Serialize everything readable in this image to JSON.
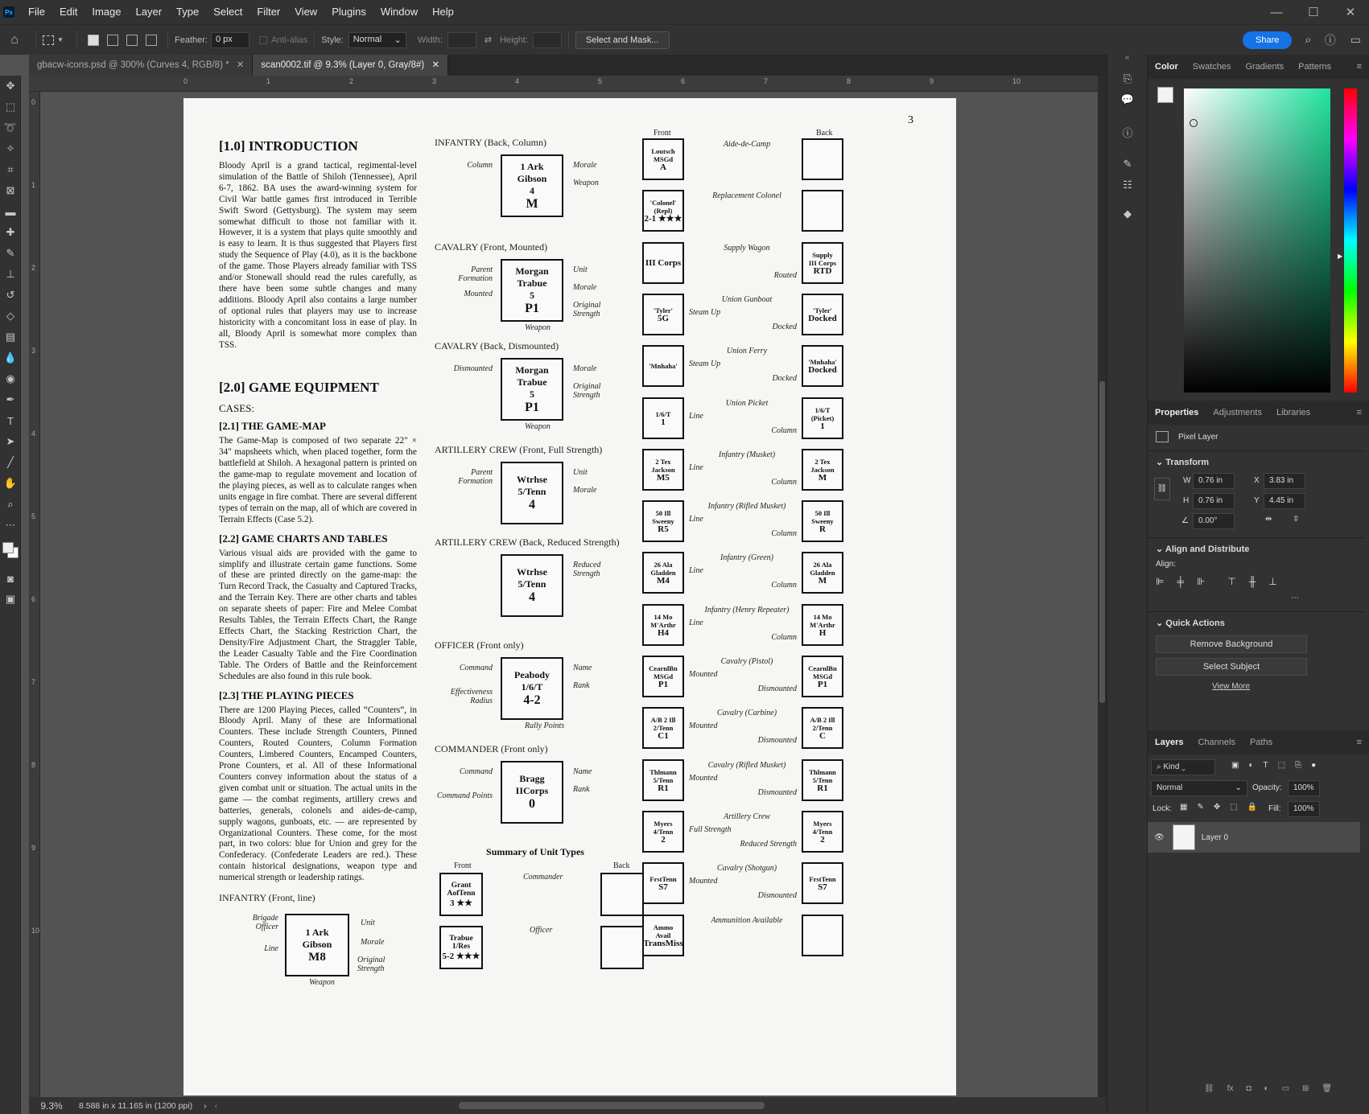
{
  "menu": [
    "File",
    "Edit",
    "Image",
    "Layer",
    "Type",
    "Select",
    "Filter",
    "View",
    "Plugins",
    "Window",
    "Help"
  ],
  "options": {
    "feather_label": "Feather:",
    "feather_value": "0 px",
    "antialias_label": "Anti-alias",
    "style_label": "Style:",
    "style_value": "Normal",
    "width_label": "Width:",
    "height_label": "Height:",
    "select_mask": "Select and Mask...",
    "share": "Share"
  },
  "tabs": [
    {
      "label": "gbacw-icons.psd @ 300% (Curves 4, RGB/8) *"
    },
    {
      "label": "scan0002.tif @ 9.3% (Layer 0, Gray/8#)"
    }
  ],
  "ruler_top": [
    "0",
    "1",
    "2",
    "3",
    "4",
    "5",
    "6",
    "7",
    "8",
    "9",
    "10"
  ],
  "ruler_left": [
    "0",
    "1",
    "2",
    "3",
    "4",
    "5",
    "6",
    "7",
    "8",
    "9",
    "10"
  ],
  "status": {
    "zoom": "9.3%",
    "doc_size": "8.588 in x 11.165 in (1200 ppi)"
  },
  "document": {
    "page_number": "3",
    "col1": {
      "h_intro": "[1.0]  INTRODUCTION",
      "intro": "Bloody April is a grand tactical, regimental-level simulation of the Battle of Shiloh (Tennessee), April 6-7, 1862. BA uses the award-winning system for Civil War battle games first introduced in Terrible Swift Sword (Gettysburg). The system may seem somewhat difficult to those not familiar with it. However, it is a system that plays quite smoothly and is easy to learn. It is thus suggested that Players first study the Sequence of Play (4.0), as it is the backbone of the game. Those Players already familiar with TSS and/or Stonewall should read the rules carefully, as there have been some subtle changes and many additions. Bloody April also contains a large number of optional rules that players may use to increase historicity with a concomitant loss in ease of play. In all, Bloody April is somewhat more complex than TSS.",
      "h_equip": "[2.0]  GAME EQUIPMENT",
      "cases": "CASES:",
      "h_map": "[2.1]  THE GAME-MAP",
      "map": "The Game-Map is composed of two separate 22\" × 34\" mapsheets which, when placed together, form the battlefield at Shiloh. A hexagonal pattern is printed on the game-map to regulate movement and location of the playing pieces, as well as to calculate ranges when units engage in fire combat. There are several different types of terrain on the map, all of which are covered in Terrain Effects (Case 5.2).",
      "h_charts": "[2.2]  GAME CHARTS AND TABLES",
      "charts": "Various visual aids are provided with the game to simplify and illustrate certain game functions. Some of these are printed directly on the game-map: the Turn Record Track, the Casualty and Captured Tracks, and the Terrain Key. There are other charts and tables on separate sheets of paper: Fire and Melee Combat Results Tables, the Terrain Effects Chart, the Range Effects Chart, the Stacking Restriction Chart, the Density/Fire Adjustment Chart, the Straggler Table, the Leader Casualty Table and the Fire Coordination Table. The Orders of Battle and the Reinforcement Schedules are also found in this rule book.",
      "h_pieces": "[2.3]  THE PLAYING PIECES",
      "pieces": "There are 1200 Playing Pieces, called “Counters”, in Bloody April. Many of these are Informational Counters. These include Strength Counters, Pinned Counters, Routed Counters, Column Formation Counters, Limbered Counters, Encamped Counters, Prone Counters, et al. All of these Informational Counters convey information about the status of a given combat unit or situation. The actual units in the game — the combat regiments, artillery crews and batteries, generals, colonels and aides-de-camp, supply wagons, gunboats, etc. — are represented by Organizational Counters. These come, for the most part, in two colors: blue for Union and grey for the Confederacy. (Confederate Leaders are red.). These contain historical designations, weapon type and numerical strength or leadership ratings.",
      "cap_inf_line": "INFANTRY (Front, line)",
      "inf_line": {
        "l1": "1 Ark",
        "l2": "Gibson",
        "l3": "M8",
        "a": "Brigade Officer",
        "b": "Line",
        "c": "Unit",
        "d": "Morale",
        "e": "Original Strength",
        "f": "Weapon"
      }
    },
    "col2": [
      {
        "cap": "INFANTRY (Back, Column)",
        "lines": [
          "1 Ark",
          "Gibson",
          "4",
          "M"
        ],
        "left": [
          "Column"
        ],
        "right": [
          "Morale",
          "Weapon"
        ],
        "bottom": ""
      },
      {
        "cap": "CAVALRY (Front, Mounted)",
        "lines": [
          "Morgan",
          "Trabue",
          "5",
          "P1"
        ],
        "left": [
          "Parent Formation",
          "Mounted"
        ],
        "right": [
          "Unit",
          "Morale",
          "Original Strength"
        ],
        "bottom": "Weapon"
      },
      {
        "cap": "CAVALRY (Back, Dismounted)",
        "lines": [
          "Morgan",
          "Trabue",
          "5",
          "P1"
        ],
        "left": [
          "Dismounted"
        ],
        "right": [
          "Morale",
          "Original Strength"
        ],
        "bottom": "Weapon"
      },
      {
        "cap": "ARTILLERY CREW (Front, Full Strength)",
        "lines": [
          "Wtrhse",
          "5/Tenn",
          "",
          "4"
        ],
        "left": [
          "Parent Formation"
        ],
        "right": [
          "Unit",
          "Morale"
        ],
        "bottom": ""
      },
      {
        "cap": "ARTILLERY CREW (Back, Reduced Strength)",
        "lines": [
          "Wtrhse",
          "5/Tenn",
          "",
          "4"
        ],
        "left": [],
        "right": [
          "Reduced Strength"
        ],
        "bottom": ""
      },
      {
        "cap": "OFFICER (Front only)",
        "lines": [
          "Peabody",
          "1/6/T",
          "",
          "4-2"
        ],
        "left": [
          "Command",
          "Effectiveness Radius"
        ],
        "right": [
          "Name",
          "Rank"
        ],
        "bottom": "Rally Points"
      },
      {
        "cap": "COMMANDER (Front only)",
        "lines": [
          "Bragg",
          "IICorps",
          "",
          "0"
        ],
        "left": [
          "Command",
          "Command Points"
        ],
        "right": [
          "Name",
          "Rank"
        ],
        "bottom": ""
      }
    ],
    "summary": {
      "title": "Summary of Unit Types",
      "front": "Front",
      "back": "Back",
      "rows": [
        {
          "front_lines": [
            "Grant",
            "AofTenn",
            "3 ★★"
          ],
          "label": "Commander"
        },
        {
          "front_lines": [
            "Trabue",
            "1/Res",
            "5-2 ★★★"
          ],
          "label": "Officer"
        }
      ]
    },
    "col3": {
      "front": "Front",
      "back": "Back",
      "rows": [
        {
          "f": [
            "Loutsch",
            "MSGd",
            "A"
          ],
          "t": "Aide-de-Camp",
          "l1": "",
          "l2": "",
          "b": []
        },
        {
          "f": [
            "'Colonel'",
            "(Repl)",
            "2-1 ★★★"
          ],
          "t": "Replacement Colonel",
          "l1": "",
          "l2": "",
          "b": []
        },
        {
          "f": [
            "",
            "",
            "III Corps"
          ],
          "t": "Supply Wagon",
          "l1": "",
          "l2": "Routed",
          "b": [
            "Supply",
            "III Corps",
            "RTD"
          ]
        },
        {
          "f": [
            "'Tyler'",
            "",
            "5G"
          ],
          "t": "Union Gunboat",
          "l1": "Steam Up",
          "l2": "Docked",
          "b": [
            "'Tyler'",
            "",
            "Docked"
          ]
        },
        {
          "f": [
            "'Mnhaha'",
            "",
            ""
          ],
          "t": "Union Ferry",
          "l1": "Steam Up",
          "l2": "Docked",
          "b": [
            "'Mnhaha'",
            "",
            "Docked"
          ]
        },
        {
          "f": [
            "1/6/T",
            "",
            "1"
          ],
          "t": "Union Picket",
          "l1": "Line",
          "l2": "Column",
          "b": [
            "1/6/T",
            "(Picket)",
            "1"
          ]
        },
        {
          "f": [
            "2 Tex",
            "Jackson",
            "M5"
          ],
          "t": "Infantry (Musket)",
          "l1": "Line",
          "l2": "Column",
          "b": [
            "2 Tex",
            "Jackson",
            "M"
          ]
        },
        {
          "f": [
            "50 Ill",
            "Sweeny",
            "R5"
          ],
          "t": "Infantry (Rifled Musket)",
          "l1": "Line",
          "l2": "Column",
          "b": [
            "50 Ill",
            "Sweeny",
            "R"
          ]
        },
        {
          "f": [
            "26 Ala",
            "Gladden",
            "M4"
          ],
          "t": "Infantry (Green)",
          "l1": "Line",
          "l2": "Column",
          "b": [
            "26 Ala",
            "Gladden",
            "M"
          ]
        },
        {
          "f": [
            "14 Mo",
            "M'Arthr",
            "H4"
          ],
          "t": "Infantry (Henry Repeater)",
          "l1": "Line",
          "l2": "Column",
          "b": [
            "14 Mo",
            "M'Arthr",
            "H"
          ]
        },
        {
          "f": [
            "CearnlBn",
            "MSGd",
            "P1"
          ],
          "t": "Cavalry (Pistol)",
          "l1": "Mounted",
          "l2": "Dismounted",
          "b": [
            "CearnlBn",
            "MSGd",
            "P1"
          ]
        },
        {
          "f": [
            "A/B 2 Ill",
            "2/Tenn",
            "C1"
          ],
          "t": "Cavalry (Carbine)",
          "l1": "Mounted",
          "l2": "Dismounted",
          "b": [
            "A/B 2 Ill",
            "2/Tenn",
            "C"
          ]
        },
        {
          "f": [
            "Thlmann",
            "5/Tenn",
            "R1"
          ],
          "t": "Cavalry (Rifled Musket)",
          "l1": "Mounted",
          "l2": "Dismounted",
          "b": [
            "Thlmann",
            "5/Tenn",
            "R1"
          ]
        },
        {
          "f": [
            "Myers",
            "4/Tenn",
            "2"
          ],
          "t": "Artillery Crew",
          "l1": "Full Strength",
          "l2": "Reduced Strength",
          "b": [
            "Myers",
            "4/Tenn",
            "2"
          ]
        },
        {
          "f": [
            "FrstTenn",
            "",
            "S7"
          ],
          "t": "Cavalry (Shotgun)",
          "l1": "Mounted",
          "l2": "Dismounted",
          "b": [
            "FrstTenn",
            "",
            "S7"
          ]
        },
        {
          "f": [
            "Ammo",
            "Avail",
            "TransMiss"
          ],
          "t": "Ammunition Available",
          "l1": "",
          "l2": "",
          "b": []
        }
      ]
    }
  },
  "panels": {
    "color_tabs": [
      "Color",
      "Swatches",
      "Gradients",
      "Patterns"
    ],
    "prop_tabs": [
      "Properties",
      "Adjustments",
      "Libraries"
    ],
    "pixel_layer": "Pixel Layer",
    "transform": "Transform",
    "w_label": "W",
    "w_value": "0.76 in",
    "x_label": "X",
    "x_value": "3.83 in",
    "h_label": "H",
    "h_value": "0.76 in",
    "y_label": "Y",
    "y_value": "4.45 in",
    "angle_value": "0.00°",
    "align_distribute": "Align and Distribute",
    "align_label": "Align:",
    "quick_actions": "Quick Actions",
    "remove_bg": "Remove Background",
    "select_subject": "Select Subject",
    "view_more": "View More",
    "layer_tabs": [
      "Layers",
      "Channels",
      "Paths"
    ],
    "kind": "Kind",
    "blend": "Normal",
    "opacity_label": "Opacity:",
    "opacity_value": "100%",
    "lock_label": "Lock:",
    "fill_label": "Fill:",
    "fill_value": "100%",
    "layer_name": "Layer 0",
    "accent": "#1473e6"
  }
}
